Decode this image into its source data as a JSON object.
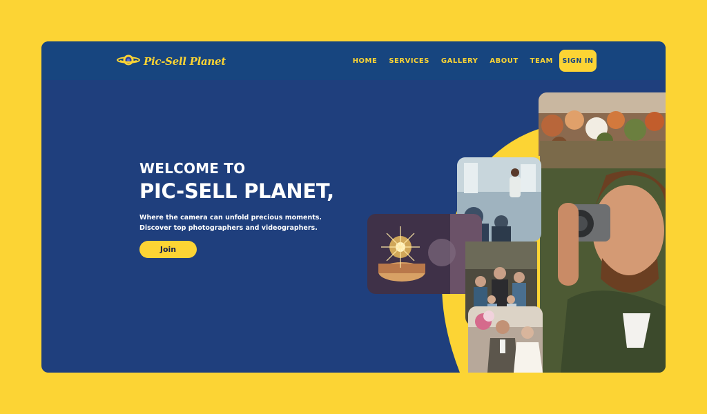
{
  "brand": {
    "logo_text": "Pic-Sell Planet",
    "logo_icon": "planet-camera-icon"
  },
  "nav": {
    "items": [
      {
        "label": "HOME"
      },
      {
        "label": "SERVICES"
      },
      {
        "label": "GALLERY"
      },
      {
        "label": "ABOUT"
      },
      {
        "label": "TEAM"
      }
    ],
    "signin_label": "SIGN IN"
  },
  "hero": {
    "welcome": "WELCOME TO",
    "title": "PIC-SELL PLANET,",
    "tagline_1": "Where the camera can unfold precious moments.",
    "tagline_2": "Discover top photographers and videographers.",
    "join_label": "Join"
  },
  "photos": [
    {
      "name": "flowers-photo"
    },
    {
      "name": "photographer-man-photo"
    },
    {
      "name": "conference-photo"
    },
    {
      "name": "birthday-cake-photo"
    },
    {
      "name": "family-photo"
    },
    {
      "name": "wedding-couple-photo"
    }
  ],
  "colors": {
    "page_background": "#FCD434",
    "frame_background": "#1F3F7D",
    "navbar": "#17457F",
    "accent": "#FCD434",
    "text": "#FFFFFF"
  }
}
